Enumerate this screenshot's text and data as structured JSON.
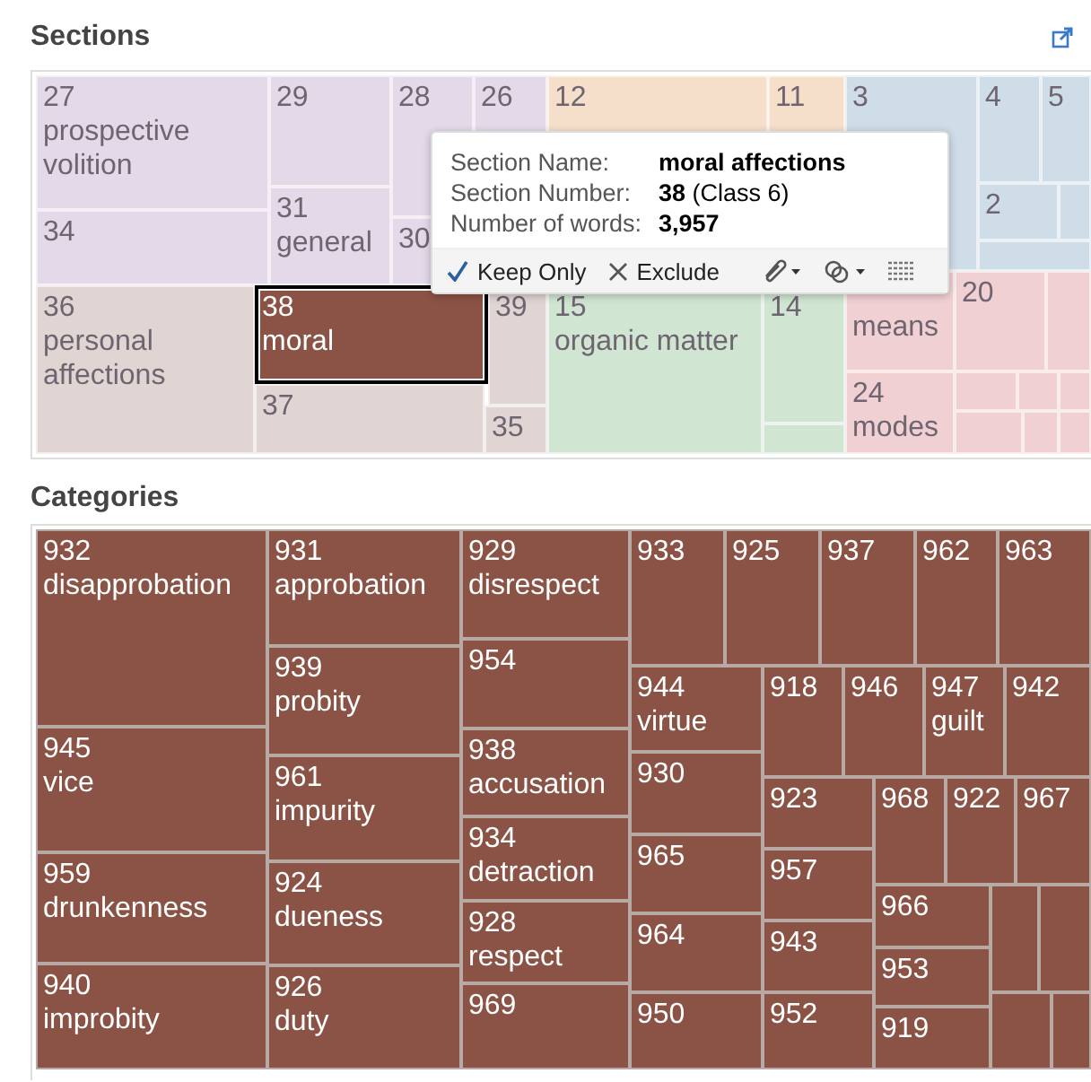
{
  "sections": {
    "title": "Sections",
    "tiles": [
      {
        "number": "27",
        "name": "prospective volition",
        "color": "#e3d9e8",
        "selected": false
      },
      {
        "number": "34",
        "color": "#e3d9e8",
        "selected": false
      },
      {
        "number": "29",
        "color": "#e3d9e8",
        "selected": false
      },
      {
        "number": "31",
        "name": "general",
        "color": "#e3d9e8",
        "selected": false
      },
      {
        "number": "28",
        "color": "#e3d9e8",
        "selected": false
      },
      {
        "number": "30",
        "color": "#e3d9e8",
        "selected": false
      },
      {
        "number": "26",
        "color": "#e3d9e8",
        "selected": false
      },
      {
        "number": "12",
        "color": "#f5dfcb",
        "selected": false
      },
      {
        "number": "11",
        "color": "#f5dfcb",
        "selected": false
      },
      {
        "number": "3",
        "color": "#cfdde9",
        "selected": false
      },
      {
        "number": "4",
        "color": "#cfdde9",
        "selected": false
      },
      {
        "number": "5",
        "color": "#cfdde9",
        "selected": false
      },
      {
        "number": "2",
        "color": "#cfdde9",
        "selected": false
      },
      {
        "number": "36",
        "name": "personal affections",
        "color": "#e1d5d3",
        "selected": false
      },
      {
        "number": "38",
        "name": "moral",
        "color": "#8b5346",
        "selected": true
      },
      {
        "number": "37",
        "color": "#e1d5d3",
        "selected": false
      },
      {
        "number": "39",
        "color": "#e1d5d3",
        "selected": false
      },
      {
        "number": "35",
        "color": "#e1d5d3",
        "selected": false
      },
      {
        "number": "15",
        "name": "organic matter",
        "color": "#d0e5d2",
        "selected": false
      },
      {
        "number": "14",
        "color": "#d0e5d2",
        "selected": false
      },
      {
        "name": "means",
        "color": "#f0d0d3",
        "selected": false
      },
      {
        "number": "20",
        "color": "#f0d0d3",
        "selected": false
      },
      {
        "number": "24",
        "name": "modes",
        "color": "#f0d0d3",
        "selected": false
      }
    ],
    "tooltip": {
      "rows": [
        {
          "label": "Section Name:",
          "value": "moral affections",
          "bold": true
        },
        {
          "label": "Section Number:",
          "value": "**38** (Class 6)",
          "bold": false
        },
        {
          "label": "Number of words:",
          "value": "3,957",
          "bold": true
        }
      ],
      "actions": [
        {
          "kind": "keep",
          "label": "Keep Only"
        },
        {
          "kind": "exclude",
          "label": "Exclude"
        },
        {
          "kind": "paperclip"
        },
        {
          "kind": "venn"
        },
        {
          "kind": "table"
        }
      ]
    }
  },
  "categories": {
    "title": "Categories",
    "tiles": [
      {
        "number": "932",
        "name": "disapprobation"
      },
      {
        "number": "945",
        "name": "vice"
      },
      {
        "number": "959",
        "name": "drunkenness"
      },
      {
        "number": "940",
        "name": "improbity"
      },
      {
        "number": "931",
        "name": "approbation"
      },
      {
        "number": "939",
        "name": "probity"
      },
      {
        "number": "961",
        "name": "impurity"
      },
      {
        "number": "924",
        "name": "dueness"
      },
      {
        "number": "926",
        "name": "duty"
      },
      {
        "number": "929",
        "name": "disrespect"
      },
      {
        "number": "954"
      },
      {
        "number": "938",
        "name": "accusation"
      },
      {
        "number": "934",
        "name": "detraction"
      },
      {
        "number": "928",
        "name": "respect"
      },
      {
        "number": "969"
      },
      {
        "number": "933"
      },
      {
        "number": "925"
      },
      {
        "number": "937"
      },
      {
        "number": "962"
      },
      {
        "number": "963"
      },
      {
        "number": "944",
        "name": "virtue"
      },
      {
        "number": "930"
      },
      {
        "number": "965"
      },
      {
        "number": "964"
      },
      {
        "number": "950"
      },
      {
        "number": "918"
      },
      {
        "number": "946"
      },
      {
        "number": "947",
        "name": "guilt"
      },
      {
        "number": "942"
      },
      {
        "number": "923"
      },
      {
        "number": "968"
      },
      {
        "number": "922"
      },
      {
        "number": "967"
      },
      {
        "number": "957"
      },
      {
        "number": "943"
      },
      {
        "number": "952"
      },
      {
        "number": "966"
      },
      {
        "number": "953"
      },
      {
        "number": "919"
      }
    ]
  }
}
